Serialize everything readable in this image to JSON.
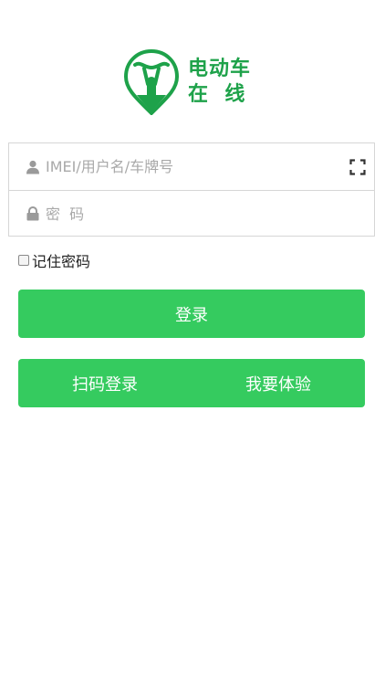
{
  "brand": {
    "name_line1": "电动车",
    "name_line2": "在  线",
    "color": "#1ea24a"
  },
  "form": {
    "username": {
      "placeholder": "IMEI/用户名/车牌号",
      "value": "",
      "icon": "user-icon"
    },
    "password": {
      "placeholder": "密  码",
      "value": "",
      "icon": "lock-icon"
    },
    "scan_icon": "scan-icon",
    "remember_label": "记住密码",
    "remember_checked": false
  },
  "buttons": {
    "login": "登录",
    "scan_login": "扫码登录",
    "experience": "我要体验",
    "color": "#35cb5f"
  }
}
